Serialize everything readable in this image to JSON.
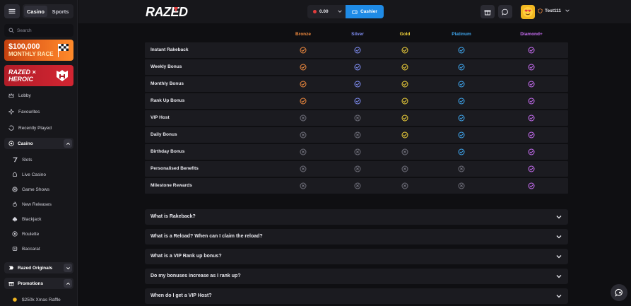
{
  "sidebar": {
    "tabs": [
      {
        "label": "Casino"
      },
      {
        "label": "Sports"
      }
    ],
    "search_placeholder": "Search",
    "banner_race": {
      "line1": "$100,000",
      "line2": "MONTHLY RACE"
    },
    "banner_heroic": {
      "line1": "RAZED ×",
      "line2": "HEROIC"
    },
    "nav": [
      {
        "label": "Lobby",
        "icon": "crown-icon"
      },
      {
        "label": "Favourites",
        "icon": "sparkle-icon"
      },
      {
        "label": "Recently Played",
        "icon": "history-icon"
      }
    ],
    "casino_section": {
      "label": "Casino",
      "icon": "chip-icon"
    },
    "casino_items": [
      {
        "label": "Slots",
        "icon": "seven-icon"
      },
      {
        "label": "Live Casino",
        "icon": "live-icon"
      },
      {
        "label": "Game Shows",
        "icon": "wheel-icon"
      },
      {
        "label": "New Releases",
        "icon": "flame-icon"
      },
      {
        "label": "Blackjack",
        "icon": "spade-icon"
      },
      {
        "label": "Roulette",
        "icon": "roulette-icon"
      },
      {
        "label": "Baccarat",
        "icon": "baccarat-icon"
      }
    ],
    "originals_section": {
      "label": "Razed Originals",
      "icon": "razed-icon"
    },
    "promotions_section": {
      "label": "Promotions",
      "icon": "gift-icon"
    },
    "promo_items": [
      {
        "label": "$250k Xmas Raffle",
        "icon": "ticket-icon"
      }
    ]
  },
  "header": {
    "logo_text": "RAZED",
    "balance": "0.00",
    "cashier_label": "Cashier",
    "username": "Test111"
  },
  "tiers": [
    {
      "name": "Bronze",
      "color": "#f08a3e"
    },
    {
      "name": "Silver",
      "color": "#7f8df2"
    },
    {
      "name": "Gold",
      "color": "#f2d33a"
    },
    {
      "name": "Platinum",
      "color": "#3fa6ee"
    },
    {
      "name": "Diamond+",
      "color": "#c76df2"
    }
  ],
  "benefits": [
    {
      "label": "Instant Rakeback",
      "values": [
        true,
        true,
        true,
        true,
        true
      ]
    },
    {
      "label": "Weekly Bonus",
      "values": [
        true,
        true,
        true,
        true,
        true
      ]
    },
    {
      "label": "Monthly Bonus",
      "values": [
        true,
        true,
        true,
        true,
        true
      ]
    },
    {
      "label": "Rank Up Bonus",
      "values": [
        true,
        true,
        true,
        true,
        true
      ]
    },
    {
      "label": "VIP Host",
      "values": [
        false,
        false,
        true,
        true,
        true
      ]
    },
    {
      "label": "Daily Bonus",
      "values": [
        false,
        false,
        true,
        true,
        true
      ]
    },
    {
      "label": "Birthday Bonus",
      "values": [
        false,
        false,
        false,
        true,
        true
      ]
    },
    {
      "label": "Personalised Benefits",
      "values": [
        false,
        false,
        false,
        false,
        true
      ]
    },
    {
      "label": "Milestone Rewards",
      "values": [
        false,
        false,
        false,
        false,
        true
      ]
    }
  ],
  "faq": [
    {
      "question": "What is Rakeback?"
    },
    {
      "question": "What is a Reload? When can I claim the reload?"
    },
    {
      "question": "What is a VIP Rank up bonus?"
    },
    {
      "question": "Do my bonuses increase as I rank up?"
    },
    {
      "question": "When do I get a VIP Host?"
    }
  ],
  "colors": {
    "accent": "#1f8be6",
    "cross": "#6f6f7a"
  }
}
